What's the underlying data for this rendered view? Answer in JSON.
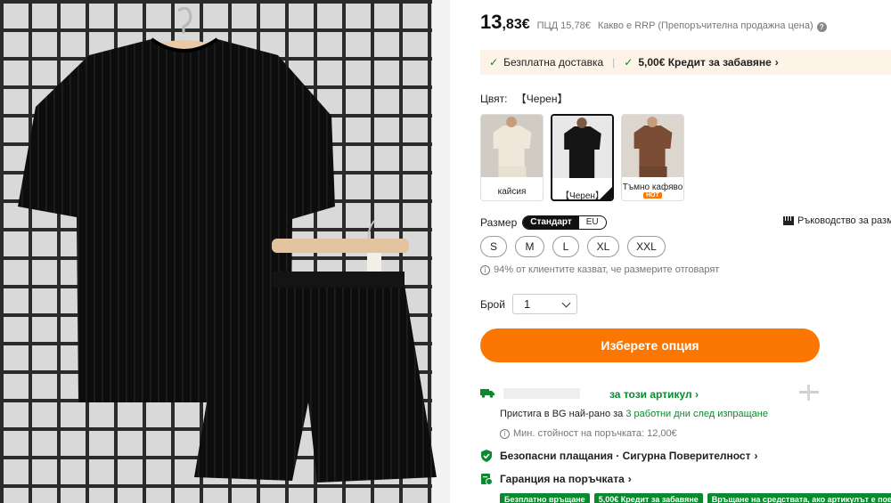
{
  "price": {
    "integer": "13",
    "decimal": ",83€",
    "rrp": "ПЦД 15,78€",
    "what_is": "Какво е RRP (Препоръчителна продажна цена)"
  },
  "promo": {
    "free_shipping": "Безплатна доставка",
    "credit": "5,00€ Кредит за забавяне"
  },
  "color": {
    "label": "Цвят:",
    "selected": "【Черен】",
    "options": [
      {
        "label": "кайсия",
        "hot": ""
      },
      {
        "label": "【Черен】",
        "hot": ""
      },
      {
        "label": "Тъмно кафяво",
        "hot": "HOT"
      }
    ]
  },
  "size": {
    "label": "Размер",
    "standard": "Стандарт",
    "eu": "EU",
    "guide": "Ръководство за разм",
    "options": [
      "S",
      "M",
      "L",
      "XL",
      "XXL"
    ],
    "fit_note": "94% от клиентите казват, че размерите отговарят"
  },
  "quantity": {
    "label": "Брой",
    "value": "1"
  },
  "cta_label": "Изберете опция",
  "shipping": {
    "link": "за този артикул",
    "arrive_prefix": "Пристига в BG най-рано за",
    "arrive_days": "3 работни дни след изпращане",
    "min_value": "Мин. стойност на поръчката: 12,00€"
  },
  "secure_payments": "Безопасни плащания · Сигурна Поверителност",
  "guarantee": "Гаранция на поръчката",
  "badges": [
    "Безплатно връщане",
    "5,00€ Кредит за забавяне",
    "Връщане на средствата, ако артикулът е повреден"
  ],
  "colors": {
    "accent": "#fb7701",
    "green": "#0a8a2e",
    "promo_bg": "#fdf3e6"
  }
}
